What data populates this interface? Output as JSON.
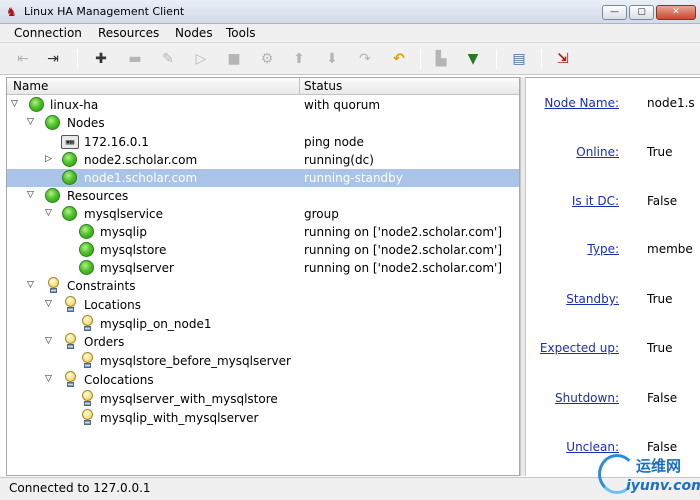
{
  "window": {
    "title": "Linux HA Management Client",
    "min_glyph": "—",
    "max_glyph": "▢",
    "close_glyph": "✕"
  },
  "menu": [
    "Connection",
    "Resources",
    "Nodes",
    "Tools"
  ],
  "toolbar": {
    "icons": [
      "disconnect-icon",
      "connect-icon",
      "add-icon",
      "remove-icon",
      "cleanup-icon",
      "start-icon",
      "stop-icon",
      "settings-icon",
      "move-up-icon",
      "move-down-icon",
      "redo-icon",
      "undo-icon",
      "standby-icon",
      "active-icon",
      "view-xml-icon",
      "exit-icon"
    ]
  },
  "tree": {
    "headers": {
      "name": "Name",
      "status": "Status"
    },
    "rows": [
      {
        "label": "linux-ha",
        "status": "with quorum"
      },
      {
        "label": "Nodes",
        "status": ""
      },
      {
        "label": "172.16.0.1",
        "status": "ping node",
        "icon_text": "▣▦"
      },
      {
        "label": "node2.scholar.com",
        "status": "running(dc)"
      },
      {
        "label": "node1.scholar.com",
        "status": "running-standby",
        "selected": true
      },
      {
        "label": "Resources",
        "status": ""
      },
      {
        "label": "mysqlservice",
        "status": "group"
      },
      {
        "label": "mysqlip",
        "status": "running on ['node2.scholar.com']"
      },
      {
        "label": "mysqlstore",
        "status": "running on ['node2.scholar.com']"
      },
      {
        "label": "mysqlserver",
        "status": "running on ['node2.scholar.com']"
      },
      {
        "label": "Constraints",
        "status": ""
      },
      {
        "label": "Locations",
        "status": ""
      },
      {
        "label": "mysqlip_on_node1",
        "status": ""
      },
      {
        "label": "Orders",
        "status": ""
      },
      {
        "label": "mysqlstore_before_mysqlserver",
        "status": ""
      },
      {
        "label": "Colocations",
        "status": ""
      },
      {
        "label": "mysqlserver_with_mysqlstore",
        "status": ""
      },
      {
        "label": "mysqlip_with_mysqlserver",
        "status": ""
      }
    ]
  },
  "properties": [
    {
      "label": "Node Name:",
      "value": "node1.s"
    },
    {
      "label": "Online:",
      "value": "True"
    },
    {
      "label": "Is it DC:",
      "value": "False"
    },
    {
      "label": "Type:",
      "value": "membe"
    },
    {
      "label": "Standby:",
      "value": "True"
    },
    {
      "label": "Expected up:",
      "value": "True"
    },
    {
      "label": "Shutdown:",
      "value": "False"
    },
    {
      "label": "Unclean:",
      "value": "False"
    }
  ],
  "status_bar": {
    "text": "Connected to 127.0.0.1"
  },
  "watermark": {
    "brand": "运维网",
    "url": "iyunv.com"
  },
  "colors": {
    "selection": "#a9c4e6",
    "link": "#1a2eb0",
    "running": "#4fc42a"
  }
}
